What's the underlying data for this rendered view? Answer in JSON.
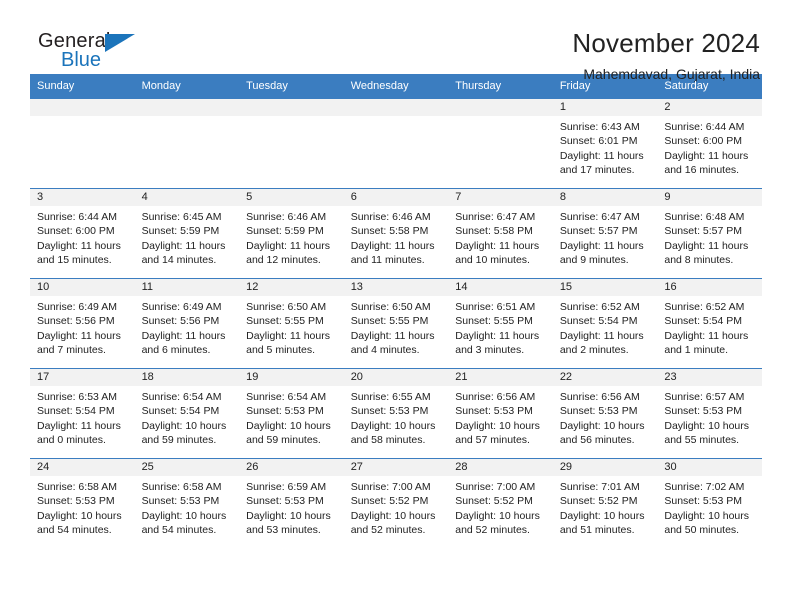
{
  "brand": {
    "name_part1": "General",
    "name_part2": "Blue",
    "accent_color": "#1b74bb"
  },
  "header": {
    "title": "November 2024",
    "subtitle": "Mahemdavad, Gujarat, India"
  },
  "calendar": {
    "header_background": "#3b7dc0",
    "daynum_background": "#f2f2f2",
    "weekday_labels": [
      "Sunday",
      "Monday",
      "Tuesday",
      "Wednesday",
      "Thursday",
      "Friday",
      "Saturday"
    ],
    "weeks": [
      [
        {
          "day": "",
          "lines": []
        },
        {
          "day": "",
          "lines": []
        },
        {
          "day": "",
          "lines": []
        },
        {
          "day": "",
          "lines": []
        },
        {
          "day": "",
          "lines": []
        },
        {
          "day": "1",
          "lines": [
            "Sunrise: 6:43 AM",
            "Sunset: 6:01 PM",
            "Daylight: 11 hours",
            "and 17 minutes."
          ]
        },
        {
          "day": "2",
          "lines": [
            "Sunrise: 6:44 AM",
            "Sunset: 6:00 PM",
            "Daylight: 11 hours",
            "and 16 minutes."
          ]
        }
      ],
      [
        {
          "day": "3",
          "lines": [
            "Sunrise: 6:44 AM",
            "Sunset: 6:00 PM",
            "Daylight: 11 hours",
            "and 15 minutes."
          ]
        },
        {
          "day": "4",
          "lines": [
            "Sunrise: 6:45 AM",
            "Sunset: 5:59 PM",
            "Daylight: 11 hours",
            "and 14 minutes."
          ]
        },
        {
          "day": "5",
          "lines": [
            "Sunrise: 6:46 AM",
            "Sunset: 5:59 PM",
            "Daylight: 11 hours",
            "and 12 minutes."
          ]
        },
        {
          "day": "6",
          "lines": [
            "Sunrise: 6:46 AM",
            "Sunset: 5:58 PM",
            "Daylight: 11 hours",
            "and 11 minutes."
          ]
        },
        {
          "day": "7",
          "lines": [
            "Sunrise: 6:47 AM",
            "Sunset: 5:58 PM",
            "Daylight: 11 hours",
            "and 10 minutes."
          ]
        },
        {
          "day": "8",
          "lines": [
            "Sunrise: 6:47 AM",
            "Sunset: 5:57 PM",
            "Daylight: 11 hours",
            "and 9 minutes."
          ]
        },
        {
          "day": "9",
          "lines": [
            "Sunrise: 6:48 AM",
            "Sunset: 5:57 PM",
            "Daylight: 11 hours",
            "and 8 minutes."
          ]
        }
      ],
      [
        {
          "day": "10",
          "lines": [
            "Sunrise: 6:49 AM",
            "Sunset: 5:56 PM",
            "Daylight: 11 hours",
            "and 7 minutes."
          ]
        },
        {
          "day": "11",
          "lines": [
            "Sunrise: 6:49 AM",
            "Sunset: 5:56 PM",
            "Daylight: 11 hours",
            "and 6 minutes."
          ]
        },
        {
          "day": "12",
          "lines": [
            "Sunrise: 6:50 AM",
            "Sunset: 5:55 PM",
            "Daylight: 11 hours",
            "and 5 minutes."
          ]
        },
        {
          "day": "13",
          "lines": [
            "Sunrise: 6:50 AM",
            "Sunset: 5:55 PM",
            "Daylight: 11 hours",
            "and 4 minutes."
          ]
        },
        {
          "day": "14",
          "lines": [
            "Sunrise: 6:51 AM",
            "Sunset: 5:55 PM",
            "Daylight: 11 hours",
            "and 3 minutes."
          ]
        },
        {
          "day": "15",
          "lines": [
            "Sunrise: 6:52 AM",
            "Sunset: 5:54 PM",
            "Daylight: 11 hours",
            "and 2 minutes."
          ]
        },
        {
          "day": "16",
          "lines": [
            "Sunrise: 6:52 AM",
            "Sunset: 5:54 PM",
            "Daylight: 11 hours",
            "and 1 minute."
          ]
        }
      ],
      [
        {
          "day": "17",
          "lines": [
            "Sunrise: 6:53 AM",
            "Sunset: 5:54 PM",
            "Daylight: 11 hours",
            "and 0 minutes."
          ]
        },
        {
          "day": "18",
          "lines": [
            "Sunrise: 6:54 AM",
            "Sunset: 5:54 PM",
            "Daylight: 10 hours",
            "and 59 minutes."
          ]
        },
        {
          "day": "19",
          "lines": [
            "Sunrise: 6:54 AM",
            "Sunset: 5:53 PM",
            "Daylight: 10 hours",
            "and 59 minutes."
          ]
        },
        {
          "day": "20",
          "lines": [
            "Sunrise: 6:55 AM",
            "Sunset: 5:53 PM",
            "Daylight: 10 hours",
            "and 58 minutes."
          ]
        },
        {
          "day": "21",
          "lines": [
            "Sunrise: 6:56 AM",
            "Sunset: 5:53 PM",
            "Daylight: 10 hours",
            "and 57 minutes."
          ]
        },
        {
          "day": "22",
          "lines": [
            "Sunrise: 6:56 AM",
            "Sunset: 5:53 PM",
            "Daylight: 10 hours",
            "and 56 minutes."
          ]
        },
        {
          "day": "23",
          "lines": [
            "Sunrise: 6:57 AM",
            "Sunset: 5:53 PM",
            "Daylight: 10 hours",
            "and 55 minutes."
          ]
        }
      ],
      [
        {
          "day": "24",
          "lines": [
            "Sunrise: 6:58 AM",
            "Sunset: 5:53 PM",
            "Daylight: 10 hours",
            "and 54 minutes."
          ]
        },
        {
          "day": "25",
          "lines": [
            "Sunrise: 6:58 AM",
            "Sunset: 5:53 PM",
            "Daylight: 10 hours",
            "and 54 minutes."
          ]
        },
        {
          "day": "26",
          "lines": [
            "Sunrise: 6:59 AM",
            "Sunset: 5:53 PM",
            "Daylight: 10 hours",
            "and 53 minutes."
          ]
        },
        {
          "day": "27",
          "lines": [
            "Sunrise: 7:00 AM",
            "Sunset: 5:52 PM",
            "Daylight: 10 hours",
            "and 52 minutes."
          ]
        },
        {
          "day": "28",
          "lines": [
            "Sunrise: 7:00 AM",
            "Sunset: 5:52 PM",
            "Daylight: 10 hours",
            "and 52 minutes."
          ]
        },
        {
          "day": "29",
          "lines": [
            "Sunrise: 7:01 AM",
            "Sunset: 5:52 PM",
            "Daylight: 10 hours",
            "and 51 minutes."
          ]
        },
        {
          "day": "30",
          "lines": [
            "Sunrise: 7:02 AM",
            "Sunset: 5:53 PM",
            "Daylight: 10 hours",
            "and 50 minutes."
          ]
        }
      ]
    ]
  }
}
